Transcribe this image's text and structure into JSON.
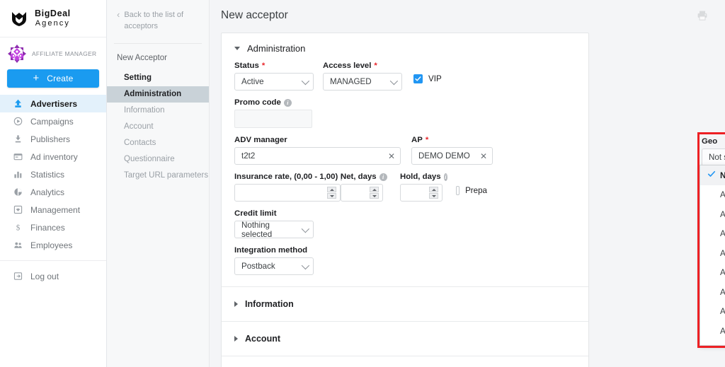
{
  "brand": {
    "line1": "BigDeal",
    "line2": "Agency",
    "logo_icon": "shield-logo-icon"
  },
  "account": {
    "role": "AFFILIATE MANAGER",
    "avatar_icon": "user-avatar-pattern"
  },
  "sidebar": {
    "create_label": "Create",
    "items": [
      {
        "label": "Advertisers",
        "icon": "upload-arrow-icon",
        "active": true
      },
      {
        "label": "Campaigns",
        "icon": "play-circle-icon",
        "active": false
      },
      {
        "label": "Publishers",
        "icon": "download-arrow-icon",
        "active": false
      },
      {
        "label": "Ad inventory",
        "icon": "window-list-icon",
        "active": false
      },
      {
        "label": "Statistics",
        "icon": "bar-chart-icon",
        "active": false
      },
      {
        "label": "Analytics",
        "icon": "pie-chart-icon",
        "active": false
      },
      {
        "label": "Management",
        "icon": "settings-square-icon",
        "active": false
      },
      {
        "label": "Finances",
        "icon": "dollar-sign-icon",
        "active": false
      },
      {
        "label": "Employees",
        "icon": "people-icon",
        "active": false
      }
    ],
    "logout": {
      "label": "Log out",
      "icon": "logout-arrow-icon"
    }
  },
  "subnav": {
    "back_label": "Back to the list of acceptors",
    "back_icon": "chevron-left-icon",
    "title": "New Acceptor",
    "items": [
      {
        "label": "Setting",
        "state": "bold"
      },
      {
        "label": "Administration",
        "state": "selected"
      },
      {
        "label": "Information",
        "state": "normal"
      },
      {
        "label": "Account",
        "state": "normal"
      },
      {
        "label": "Contacts",
        "state": "normal"
      },
      {
        "label": "Questionnaire",
        "state": "normal"
      },
      {
        "label": "Target URL parameters",
        "state": "normal"
      }
    ]
  },
  "header": {
    "title": "New acceptor",
    "print_icon": "printer-icon"
  },
  "form": {
    "administration": {
      "title": "Administration",
      "status": {
        "label": "Status",
        "required": "*",
        "value": "Active"
      },
      "access_level": {
        "label": "Access level",
        "required": "*",
        "value": "MANAGED"
      },
      "vip": {
        "label": "VIP",
        "checked": true
      },
      "promo_code": {
        "label": "Promo code",
        "value": ""
      },
      "adv_manager": {
        "label": "ADV manager",
        "value": "t2t2",
        "clear_icon": "close-icon"
      },
      "ap": {
        "label": "AP",
        "required": "*",
        "value": "DEMO DEMO",
        "clear_icon": "close-icon"
      },
      "insurance_rate": {
        "label": "Insurance rate, (0,00 - 1,00)",
        "value": ""
      },
      "net_days": {
        "label": "Net, days",
        "value": ""
      },
      "hold_days": {
        "label": "Hold, days",
        "value": ""
      },
      "prepayment": {
        "label": "Prepa",
        "checked": false
      },
      "credit_limit": {
        "label": "Credit limit",
        "value": "Nothing selected"
      },
      "integration_method": {
        "label": "Integration method",
        "value": "Postback"
      }
    },
    "sections": [
      {
        "title": "Information"
      },
      {
        "title": "Account"
      }
    ]
  },
  "geo": {
    "label": "Geo",
    "selected": "Not selected",
    "options": [
      {
        "label": "Not selected",
        "selected": true
      },
      {
        "label": "Afghanistan",
        "selected": false
      },
      {
        "label": "Aland Islands",
        "selected": false
      },
      {
        "label": "Albania",
        "selected": false
      },
      {
        "label": "Algeria",
        "selected": false
      },
      {
        "label": "American Samoa",
        "selected": false
      },
      {
        "label": "Andorra",
        "selected": false
      },
      {
        "label": "Angola",
        "selected": false
      },
      {
        "label": "Anguilla",
        "selected": false
      }
    ]
  },
  "colors": {
    "accent_blue": "#1a9bf0",
    "highlight_red": "#ed2024",
    "required_red": "#e8252a",
    "checkbox_blue": "#2196f3",
    "page_bg": "#f4f5f7",
    "sidebar_active_bg": "#e3f1fb",
    "subnav_selected_bg": "#c9d2d8"
  }
}
